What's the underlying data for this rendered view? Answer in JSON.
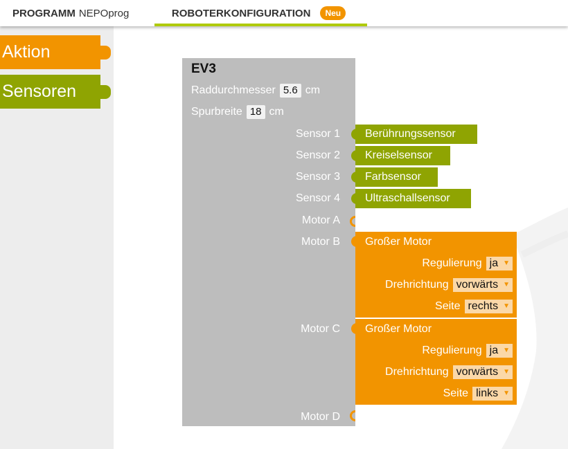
{
  "tabs": {
    "program": {
      "bold": "PROGRAMM",
      "name": "NEPOprog"
    },
    "config": {
      "label": "ROBOTERKONFIGURATION",
      "badge": "Neu"
    }
  },
  "toolbox": {
    "aktion": "Aktion",
    "sensoren": "Sensoren"
  },
  "colors": {
    "orange": "#f29400",
    "green": "#8fa402",
    "tab_underline": "#afca0b",
    "ev3_block": "#bdbdbd"
  },
  "ev3": {
    "title": "EV3",
    "wheel_label": "Raddurchmesser",
    "wheel_value": "5.6",
    "wheel_unit": "cm",
    "track_label": "Spurbreite",
    "track_value": "18",
    "track_unit": "cm",
    "ports": {
      "s1": "Sensor 1",
      "s2": "Sensor 2",
      "s3": "Sensor 3",
      "s4": "Sensor 4",
      "ma": "Motor A",
      "mb": "Motor B",
      "mc": "Motor C",
      "md": "Motor D"
    }
  },
  "sensors": {
    "s1": "Berührungssensor",
    "s2": "Kreiselsensor",
    "s3": "Farbsensor",
    "s4": "Ultraschallsensor"
  },
  "motors": {
    "b": {
      "title": "Großer Motor",
      "reg_label": "Regulierung",
      "reg": "ja",
      "dir_label": "Drehrichtung",
      "dir": "vorwärts",
      "side_label": "Seite",
      "side": "rechts"
    },
    "c": {
      "title": "Großer Motor",
      "reg_label": "Regulierung",
      "reg": "ja",
      "dir_label": "Drehrichtung",
      "dir": "vorwärts",
      "side_label": "Seite",
      "side": "links"
    }
  },
  "icons": {
    "dropdown": "triangle-down-icon",
    "notch": "connector-notch-icon"
  }
}
